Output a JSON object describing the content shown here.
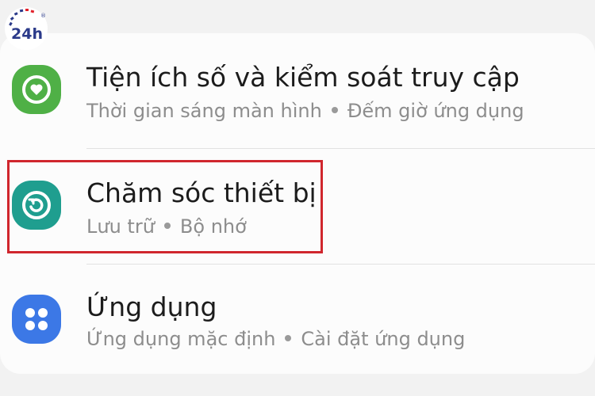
{
  "brand": {
    "logo_text": "24h",
    "logo_mark": "®",
    "colors": {
      "logo_blue": "#2b3a8a",
      "logo_red": "#e2212b"
    }
  },
  "settings": {
    "items": [
      {
        "title": "Tiện ích số và kiểm soát truy cập",
        "subtitle_parts": [
          "Thời gian sáng màn hình",
          "Đếm giờ ứng dụng"
        ],
        "icon": "digital-wellbeing-icon",
        "icon_color": "#4fb046"
      },
      {
        "title": "Chăm sóc thiết bị",
        "subtitle_parts": [
          "Lưu trữ",
          "Bộ nhớ"
        ],
        "icon": "device-care-icon",
        "icon_color": "#1f9e8f",
        "highlighted": true
      },
      {
        "title": "Ứng dụng",
        "subtitle_parts": [
          "Ứng dụng mặc định",
          "Cài đặt ứng dụng"
        ],
        "icon": "apps-icon",
        "icon_color": "#3c78e6"
      }
    ]
  },
  "highlight_color": "#d0262d"
}
